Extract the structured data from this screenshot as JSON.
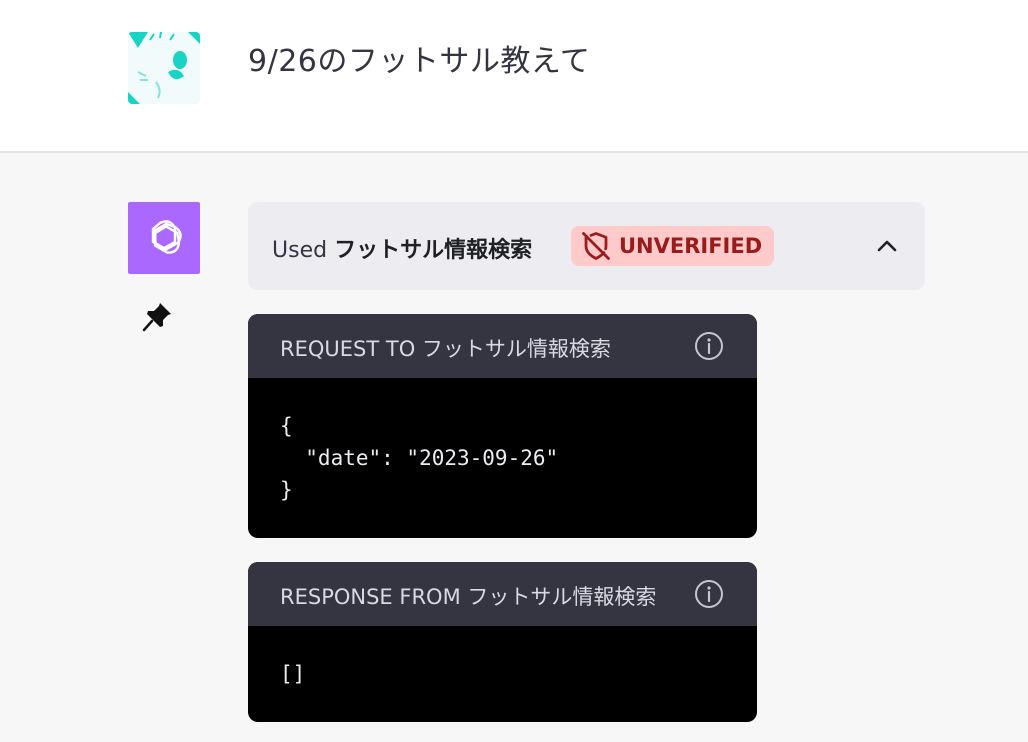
{
  "user": {
    "message": "9/26のフットサル教えて"
  },
  "plugin_bar": {
    "used_prefix": "Used",
    "plugin_name": "フットサル情報検索",
    "badge_label": "UNVERIFIED"
  },
  "request": {
    "title": "REQUEST TO フットサル情報検索",
    "body": "{\n  \"date\": \"2023-09-26\"\n}"
  },
  "response": {
    "title": "RESPONSE FROM フットサル情報検索",
    "body": "[]"
  },
  "colors": {
    "gpt_avatar": "#ab68ff",
    "badge_bg": "#fecaca",
    "badge_text": "#991b1b",
    "header_bg": "#343541",
    "user_avatar_accent": "#19d3c5"
  }
}
